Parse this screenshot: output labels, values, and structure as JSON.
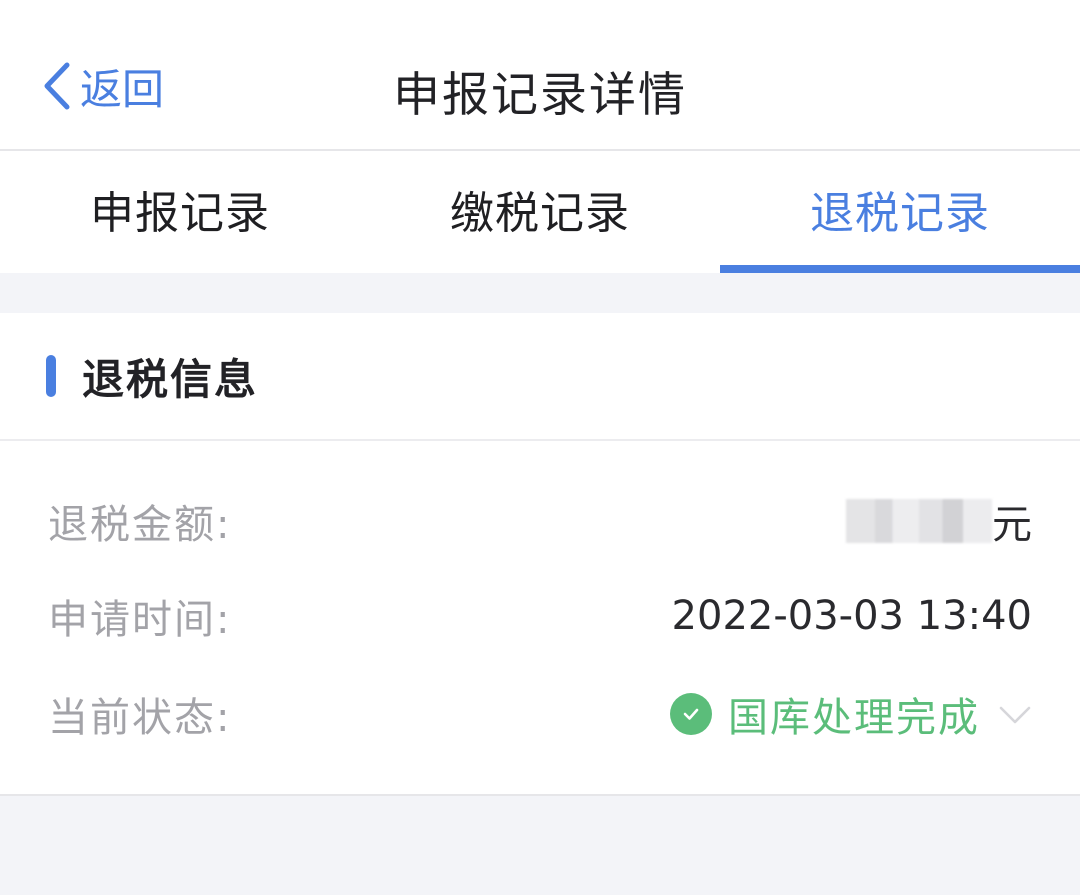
{
  "navbar": {
    "back_label": "返回",
    "title": "申报记录详情"
  },
  "tabs": [
    {
      "label": "申报记录",
      "active": false
    },
    {
      "label": "缴税记录",
      "active": false
    },
    {
      "label": "退税记录",
      "active": true
    }
  ],
  "section": {
    "title": "退税信息"
  },
  "fields": {
    "refund_amount": {
      "label": "退税金额:",
      "unit": "元"
    },
    "apply_time": {
      "label": "申请时间:",
      "value": "2022-03-03 13:40"
    },
    "status": {
      "label": "当前状态:",
      "value": "国库处理完成"
    }
  },
  "icons": {
    "back": "chevron-left-icon",
    "status": "check-circle-icon",
    "expand": "chevron-down-icon"
  },
  "colors": {
    "accent": "#4a7fe0",
    "success": "#5bbd7a",
    "background": "#f3f4f8"
  }
}
